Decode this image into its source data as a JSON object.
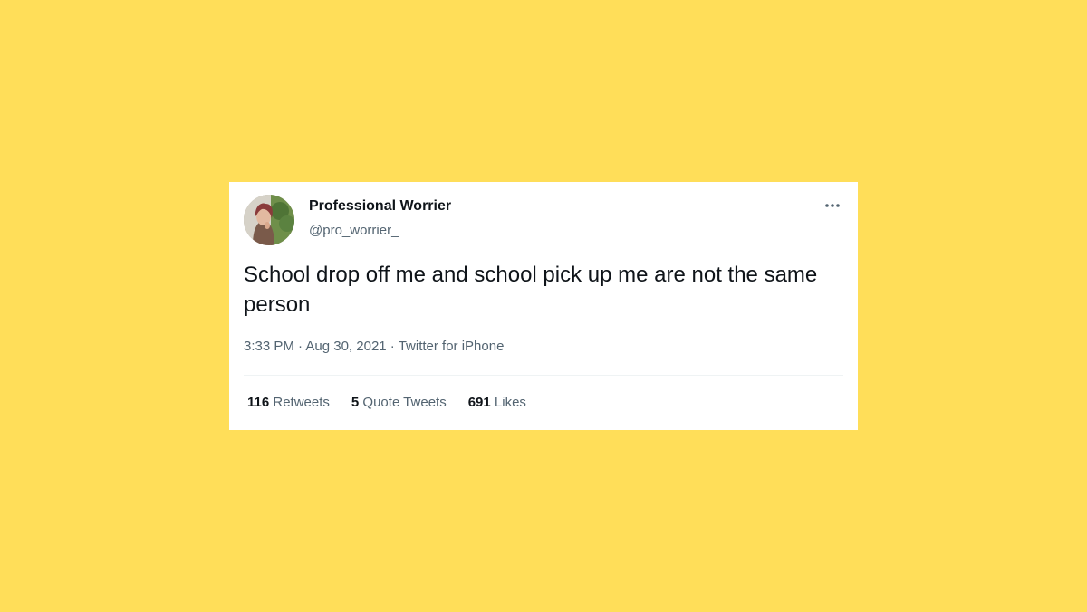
{
  "colors": {
    "background": "#FFDE59",
    "card": "#FFFFFF",
    "primary_text": "#0F1419",
    "secondary_text": "#536471",
    "divider": "#EFF3F4"
  },
  "tweet": {
    "author": {
      "display_name": "Professional Worrier",
      "handle": "@pro_worrier_",
      "avatar_icon": "profile-photo"
    },
    "more_icon": "more-horizontal-icon",
    "text": "School drop off me and school pick up me are not the same person",
    "meta": {
      "time": "3:33 PM",
      "separator": " · ",
      "date": "Aug 30, 2021",
      "source": "Twitter for iPhone"
    },
    "stats": [
      {
        "count": "116",
        "label": "Retweets"
      },
      {
        "count": "5",
        "label": "Quote Tweets"
      },
      {
        "count": "691",
        "label": "Likes"
      }
    ]
  }
}
